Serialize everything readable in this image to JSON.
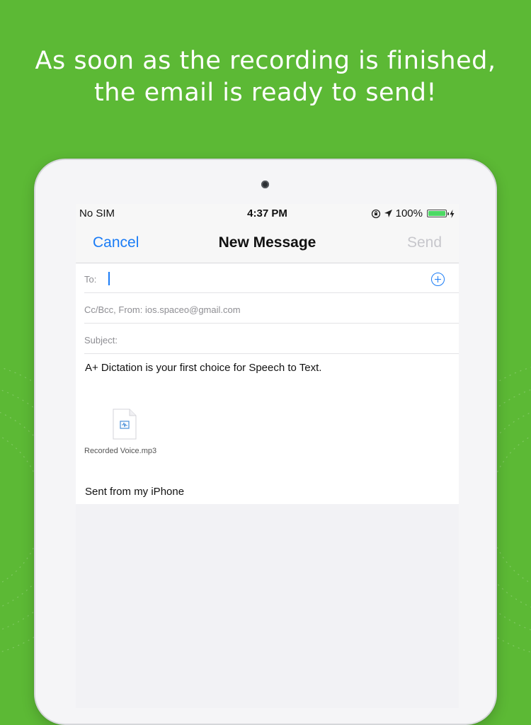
{
  "headline": {
    "line1": "As soon as the recording is finished,",
    "line2": "the email is ready to send!"
  },
  "status_bar": {
    "carrier": "No SIM",
    "time": "4:37 PM",
    "battery": "100%",
    "battery_level": 1.0
  },
  "nav_bar": {
    "cancel_label": "Cancel",
    "title": "New Message",
    "send_label": "Send"
  },
  "compose": {
    "to_label": "To:",
    "cc_label": "Cc/Bcc, From:",
    "from_address": "ios.spaceo@gmail.com",
    "subject_label": "Subject:",
    "body": "A+ Dictation is your first choice for Speech to Text.",
    "attachment_name": "Recorded Voice.mp3",
    "signature": "Sent from my iPhone"
  },
  "icons": {
    "orientation_lock": "orientation-lock-icon",
    "location": "location-arrow-icon",
    "charging": "charging-bolt-icon",
    "add_contact": "add-contact-icon",
    "file": "audio-file-icon"
  },
  "colors": {
    "background": "#5cb935",
    "accent": "#1a7cf6",
    "send_disabled": "#c7c7cc",
    "battery": "#4cd964"
  }
}
